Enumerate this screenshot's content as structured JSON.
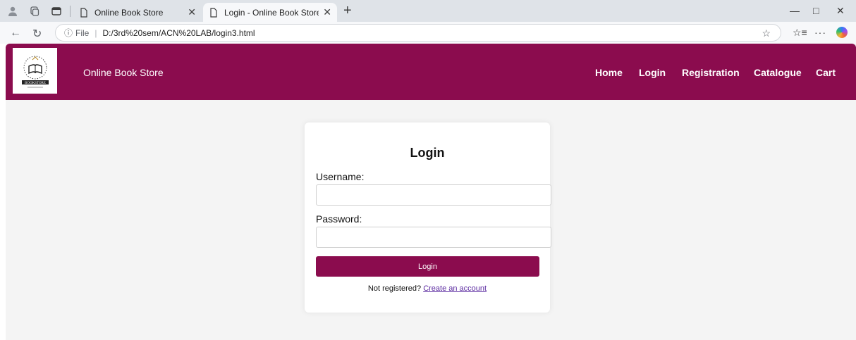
{
  "browser": {
    "tabs": [
      {
        "title": "Online Book Store",
        "active": false
      },
      {
        "title": "Login - Online Book Store",
        "active": true
      }
    ],
    "address": {
      "scheme": "File",
      "path": "D:/3rd%20sem/ACN%20LAB/login3.html"
    },
    "icons": [
      "profile-icon",
      "workspaces-icon",
      "tab-actions-icon",
      "back-icon",
      "refresh-icon",
      "info-icon",
      "favorite-star-icon",
      "favorites-icon",
      "more-icon",
      "copilot-icon"
    ]
  },
  "site": {
    "logo_text": "BOOKSTORE",
    "title": "Online Book Store",
    "nav": [
      "Home",
      "Login",
      "Registration",
      "Catalogue",
      "Cart"
    ],
    "brand_color": "#8b0c4e"
  },
  "login": {
    "heading": "Login",
    "username_label": "Username:",
    "username_value": "",
    "password_label": "Password:",
    "password_value": "",
    "button_label": "Login",
    "register_prompt": "Not registered?",
    "register_link": "Create an account"
  }
}
